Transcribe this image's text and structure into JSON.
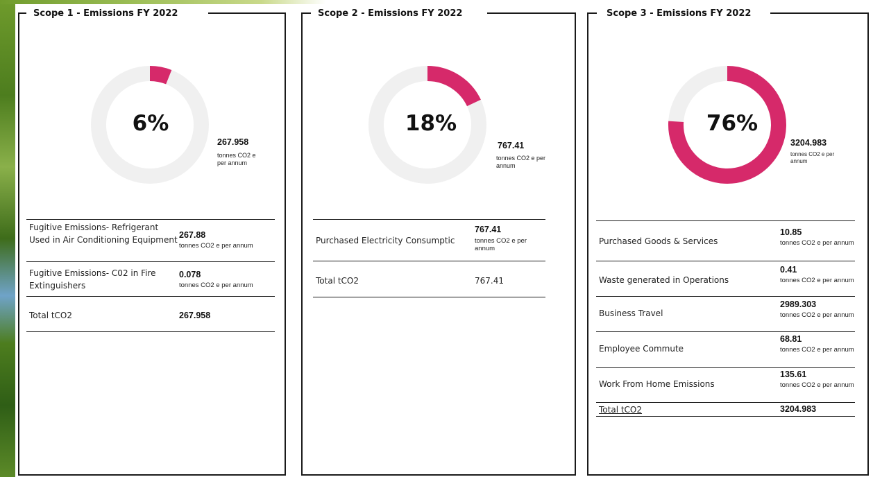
{
  "chart_data": [
    {
      "type": "donut",
      "title": "Scope 1 - Emissions FY 2022",
      "percent": 6,
      "percent_label": "6%",
      "total_value": "267.958",
      "unit_label": "tonnes CO2 e per annum",
      "colors": {
        "fill": "#d6296a",
        "track": "#f0f0f0"
      },
      "rows": [
        {
          "label": "Fugitive Emissions- Refrigerant Used in Air Conditioning Equipment",
          "value": "267.88",
          "unit": "tonnes CO2 e per annum"
        },
        {
          "label": "Fugitive Emissions- C02 in Fire Extinguishers",
          "value": "0.078",
          "unit": "tonnes CO2 e per annum"
        }
      ],
      "total_label": "Total  tCO2",
      "total": "267.958"
    },
    {
      "type": "donut",
      "title": "Scope 2 - Emissions FY 2022",
      "percent": 18,
      "percent_label": "18%",
      "total_value": "767.41",
      "unit_label": "tonnes CO2 e per annum",
      "colors": {
        "fill": "#d6296a",
        "track": "#f0f0f0"
      },
      "rows": [
        {
          "label": "Purchased Electricity Consumptic",
          "value": "767.41",
          "unit": "tonnes CO2 e per annum"
        }
      ],
      "total_label": "Total  tCO2",
      "total": "767.41"
    },
    {
      "type": "donut",
      "title": "Scope 3 - Emissions FY 2022",
      "percent": 76,
      "percent_label": "76%",
      "total_value": "3204.983",
      "unit_label": "tonnes CO2 e per annum",
      "colors": {
        "fill": "#d6296a",
        "track": "#f0f0f0"
      },
      "rows": [
        {
          "label": "Purchased Goods & Services",
          "value": "10.85",
          "unit": "tonnes CO2 e per annum"
        },
        {
          "label": "Waste generated in Operations",
          "value": "0.41",
          "unit": "tonnes CO2 e per annum"
        },
        {
          "label": "Business Travel",
          "value": "2989.303",
          "unit": "tonnes CO2 e per annum"
        },
        {
          "label": "Employee Commute",
          "value": "68.81",
          "unit": "tonnes CO2 e per annum"
        },
        {
          "label": "Work From Home Emissions",
          "value": "135.61",
          "unit": "tonnes CO2 e per annum"
        }
      ],
      "total_label": "Total  tCO2",
      "total": "3204.983"
    }
  ]
}
